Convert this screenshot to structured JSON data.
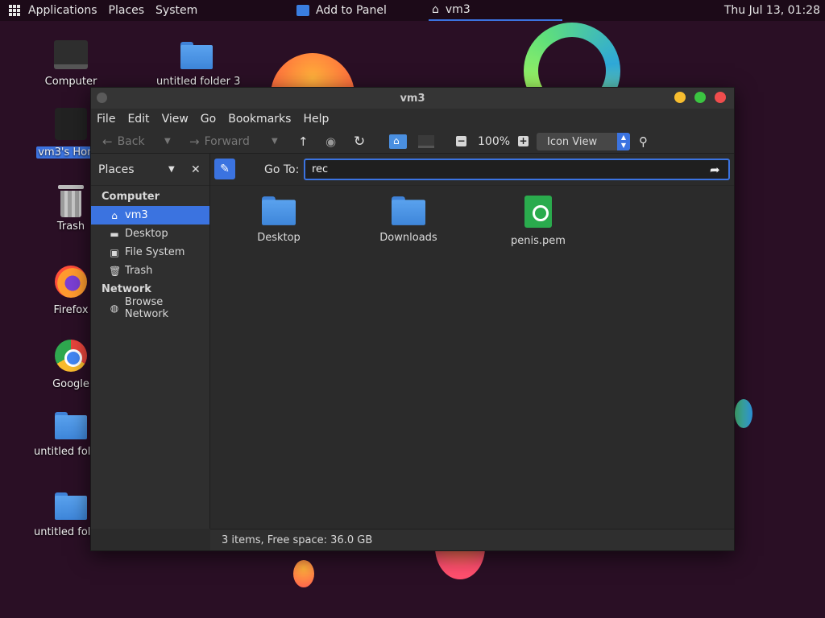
{
  "top_panel": {
    "menus": [
      "Applications",
      "Places",
      "System"
    ],
    "tasks": {
      "add_to_panel": "Add to Panel",
      "window": "vm3"
    },
    "clock": "Thu Jul 13, 01:28"
  },
  "desktop": {
    "icons": {
      "computer": "Computer",
      "untitled_folder_3": "untitled folder 3",
      "home": "vm3's Home",
      "trash": "Trash",
      "firefox": "Firefox",
      "google": "Google",
      "untitled_folder_a": "untitled folder",
      "untitled_folder_b": "untitled folder"
    }
  },
  "window": {
    "title": "vm3",
    "menubar": [
      "File",
      "Edit",
      "View",
      "Go",
      "Bookmarks",
      "Help"
    ],
    "toolbar": {
      "back": "Back",
      "forward": "Forward",
      "zoom": "100%",
      "view_mode": "Icon View"
    },
    "sidebar": {
      "header": "Places",
      "groups": {
        "computer": "Computer",
        "network": "Network"
      },
      "items": {
        "vm3": "vm3",
        "desktop": "Desktop",
        "file_system": "File System",
        "trash": "Trash",
        "browse_network": "Browse Network"
      }
    },
    "location": {
      "label": "Go To:",
      "value": "rec"
    },
    "files": [
      {
        "name": "Desktop"
      },
      {
        "name": "Downloads"
      },
      {
        "name": "penis.pem"
      }
    ],
    "status": "3 items, Free space: 36.0 GB"
  },
  "colors": {
    "accent": "#3b73e0",
    "desktop_bg": "#2a0f25",
    "window_bg": "#2b2b2b",
    "close": "#f04d4d",
    "maximize": "#3bc541",
    "minimize": "#f7bd2f"
  }
}
